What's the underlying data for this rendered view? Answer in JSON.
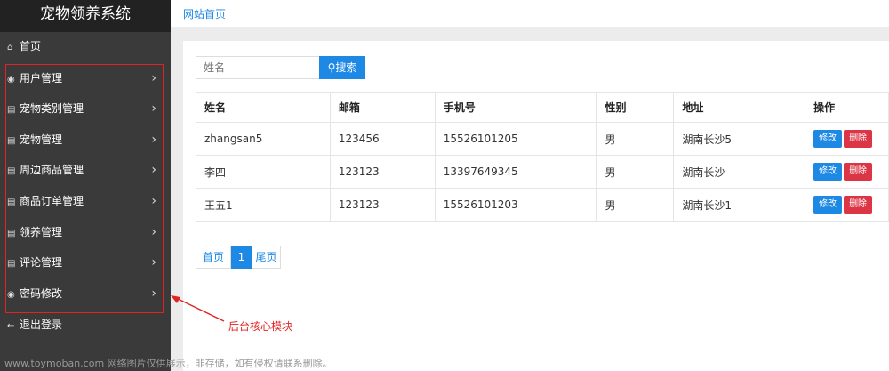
{
  "app": {
    "title": "宠物领养系统"
  },
  "sidebar": {
    "items": [
      {
        "label": "首页",
        "icon": "home-icon",
        "glyph": "⌂",
        "chevron": false
      },
      {
        "label": "用户管理",
        "icon": "user-circle-icon",
        "glyph": "◉",
        "chevron": true
      },
      {
        "label": "宠物类别管理",
        "icon": "document-icon",
        "glyph": "▤",
        "chevron": true
      },
      {
        "label": "宠物管理",
        "icon": "document-icon",
        "glyph": "▤",
        "chevron": true
      },
      {
        "label": "周边商品管理",
        "icon": "document-icon",
        "glyph": "▤",
        "chevron": true
      },
      {
        "label": "商品订单管理",
        "icon": "document-icon",
        "glyph": "▤",
        "chevron": true
      },
      {
        "label": "领养管理",
        "icon": "document-icon",
        "glyph": "▤",
        "chevron": true
      },
      {
        "label": "评论管理",
        "icon": "document-icon",
        "glyph": "▤",
        "chevron": true
      },
      {
        "label": "密码修改",
        "icon": "user-circle-icon",
        "glyph": "◉",
        "chevron": true
      },
      {
        "label": "退出登录",
        "icon": "arrow-left-icon",
        "glyph": "←",
        "chevron": false
      }
    ]
  },
  "breadcrumb": {
    "label": "网站首页"
  },
  "search": {
    "placeholder": "姓名",
    "button_label": "搜索",
    "icon": "search-icon"
  },
  "table": {
    "headers": [
      "姓名",
      "邮箱",
      "手机号",
      "性别",
      "地址",
      "操作"
    ],
    "rows": [
      {
        "name": "zhangsan5",
        "email": "123456",
        "phone": "15526101205",
        "gender": "男",
        "address": "湖南长沙5"
      },
      {
        "name": "李四",
        "email": "123123",
        "phone": "13397649345",
        "gender": "男",
        "address": "湖南长沙"
      },
      {
        "name": "王五1",
        "email": "123123",
        "phone": "15526101203",
        "gender": "男",
        "address": "湖南长沙1"
      }
    ],
    "edit_label": "修改",
    "delete_label": "删除"
  },
  "pagination": {
    "first_label": "首页",
    "current_page": "1",
    "last_label": "尾页"
  },
  "annotation": {
    "text": "后台核心模块",
    "color": "#e02424"
  },
  "watermark": {
    "text": "www.toymoban.com 网络图片仅供展示，非存储，如有侵权请联系删除。"
  },
  "colors": {
    "accent": "#1e88e5",
    "danger": "#dc3545",
    "sidebar": "#3a3a3a",
    "brand_bar": "#222222"
  }
}
